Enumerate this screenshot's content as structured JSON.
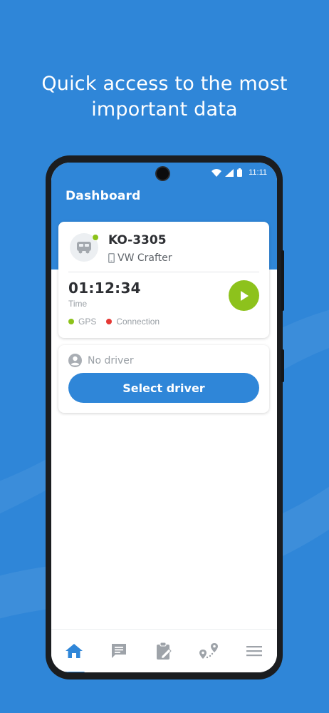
{
  "headline": {
    "line1": "Quick access to the most",
    "line2": "important data"
  },
  "status_bar": {
    "time": "11:11"
  },
  "app": {
    "title": "Dashboard"
  },
  "vehicle": {
    "plate": "KO-3305",
    "model": "VW Crafter",
    "timer": "01:12:34",
    "timer_label": "Time",
    "indicators": [
      {
        "label": "GPS",
        "color": "#8cc21a"
      },
      {
        "label": "Connection",
        "color": "#e53935"
      }
    ]
  },
  "driver": {
    "placeholder": "No driver",
    "select_label": "Select driver"
  },
  "nav": [
    "home-icon",
    "messages-icon",
    "tasks-icon",
    "route-icon",
    "menu-icon"
  ],
  "colors": {
    "brand": "#2f86d8",
    "accent_green": "#8dc21c"
  }
}
